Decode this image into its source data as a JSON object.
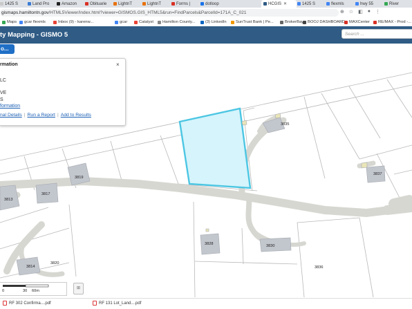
{
  "browser": {
    "tabs": [
      {
        "label": "1425 S",
        "color": "#c9c9c9"
      },
      {
        "label": "Land Pro",
        "color": "#3a7bd5"
      },
      {
        "label": "Amazon",
        "color": "#222"
      },
      {
        "label": "Obituarie",
        "color": "#d93025"
      },
      {
        "label": "LightnT",
        "color": "#e8710a"
      },
      {
        "label": "LightnT",
        "color": "#e8710a"
      },
      {
        "label": "Forms |",
        "color": "#d93025"
      },
      {
        "label": "dotloop",
        "color": "#1a73e8"
      },
      {
        "label": "HCGIS",
        "color": "#2f5b85",
        "active": true
      },
      {
        "label": "1425 S",
        "color": "#4285f4"
      },
      {
        "label": "flexmls",
        "color": "#4285f4"
      },
      {
        "label": "hwy 55",
        "color": "#4285f4"
      },
      {
        "label": "River",
        "color": "#34a853"
      }
    ],
    "url_host": "gismaps.hamiltontn.gov",
    "url_path": "/HTML5Viewer/index.html?viewer=GISMOS.GIS_HTML5&run=FindParcels&ParcelId=171A_C_021",
    "bookmarks": [
      {
        "label": "Maps",
        "color": "#34a853"
      },
      {
        "label": "gcar flexmls",
        "color": "#4285f4"
      },
      {
        "label": "Inbox (9) - karenw...",
        "color": "#ea4335"
      },
      {
        "label": "gcar",
        "color": "#4285f4"
      },
      {
        "label": "Catalyst",
        "color": "#ea4335"
      },
      {
        "label": "Hamilton County...",
        "color": "#888"
      },
      {
        "label": "(3) LinkedIn",
        "color": "#0a66c2"
      },
      {
        "label": "SunTrust Bank | Pe...",
        "color": "#f29900"
      },
      {
        "label": "BrokerBay",
        "color": "#666"
      },
      {
        "label": "BOOJ DASHBOARD",
        "color": "#444"
      },
      {
        "label": "MAXCenter",
        "color": "#d93025"
      },
      {
        "label": "RE/MAX - Prod -...",
        "color": "#d93025"
      }
    ]
  },
  "app": {
    "title": "ty Mapping - GISMO 5",
    "search_placeholder": "Search ...",
    "menu_button": "o..."
  },
  "panel": {
    "title": "rmation",
    "lines": [
      "LC",
      "VE",
      "S"
    ],
    "info_link": "formation",
    "links": [
      "nal Details",
      "Run a Report",
      "Add to Results"
    ],
    "close": "×"
  },
  "map": {
    "address_labels": [
      "3835",
      "3837",
      "3819",
      "3817",
      "3813",
      "3828",
      "3830",
      "3814",
      "3820",
      "3836"
    ],
    "scale_labels": [
      "0",
      "30",
      "60m"
    ],
    "colors": {
      "selected_stroke": "#4cc6e3",
      "selected_fill": "#d5f4fb",
      "road": "#d7d7d2",
      "building": "#c2c6cd",
      "parcel_line": "#b8b8b8"
    }
  },
  "downloads": [
    "RF 302 Confirma....pdf",
    "RF 131 Lot_Land....pdf"
  ]
}
